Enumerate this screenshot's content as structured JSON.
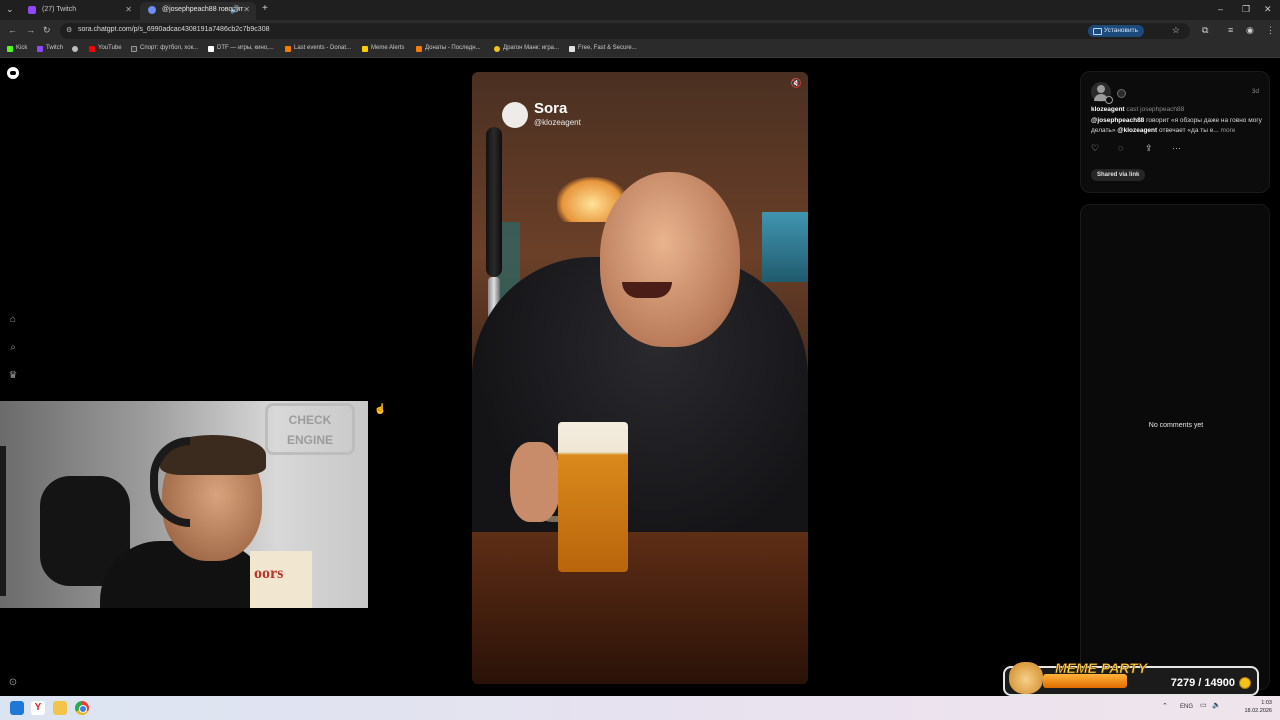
{
  "browser": {
    "tabs": [
      {
        "title": "(27) Twitch",
        "active": false
      },
      {
        "title": "@josephpeach88 говорит",
        "active": false
      }
    ],
    "new_tab_glyph": "+",
    "url": "sora.chatgpt.com/p/s_6990adcac4308191a7486cb2c7b9c308",
    "install_label": "Установить",
    "bookmarks": [
      {
        "label": "Kick",
        "color": "#53fc18"
      },
      {
        "label": "Twitch",
        "color": "#9146ff"
      },
      {
        "label": "",
        "color": "#bdbdbd"
      },
      {
        "label": "YouTube",
        "color": "#ff0000"
      },
      {
        "label": "Спорт: футбол, хок...",
        "color": "#3c3c3c"
      },
      {
        "label": "DTF — игры, кино,...",
        "color": "#ffffff"
      },
      {
        "label": "Last events - Donat...",
        "color": "#f57d07"
      },
      {
        "label": "Meme Alerts",
        "color": "#ffcc00"
      },
      {
        "label": "Донаты - Последн...",
        "color": "#f57d07"
      },
      {
        "label": "Драгон Манк: игра...",
        "color": "#f4c21c"
      },
      {
        "label": "Free, Fast & Secure...",
        "color": "#e0e0e0"
      }
    ]
  },
  "video": {
    "watermark_name": "Sora",
    "watermark_handle": "@klozeagent",
    "mute_icon": "speaker-muted-icon"
  },
  "webcam": {
    "sign_text": "CHECK ENGINE",
    "can_text": "oors"
  },
  "post": {
    "age": "3d",
    "author": "klozeagent",
    "cast_text": "cast josephpeach88",
    "mention1": "@josephpeach88",
    "text1": " говорит «я обзоры даже на говно могу делать» ",
    "mention2": "@klozeagent",
    "text2": " отвечает «да ты е...",
    "more_label": "more",
    "shared_label": "Shared via link"
  },
  "comments": {
    "empty_text": "No comments yet"
  },
  "meme_party": {
    "title": "MEME PARTY",
    "count": "7279 / 14900",
    "progress": 0.489
  },
  "taskbar": {
    "language": "ENG",
    "time": "1:03",
    "date": "18.02.2026"
  },
  "colors": {
    "background": "#000000",
    "panel": "#0c0c0c",
    "accent_install": "#1c4a7a"
  }
}
